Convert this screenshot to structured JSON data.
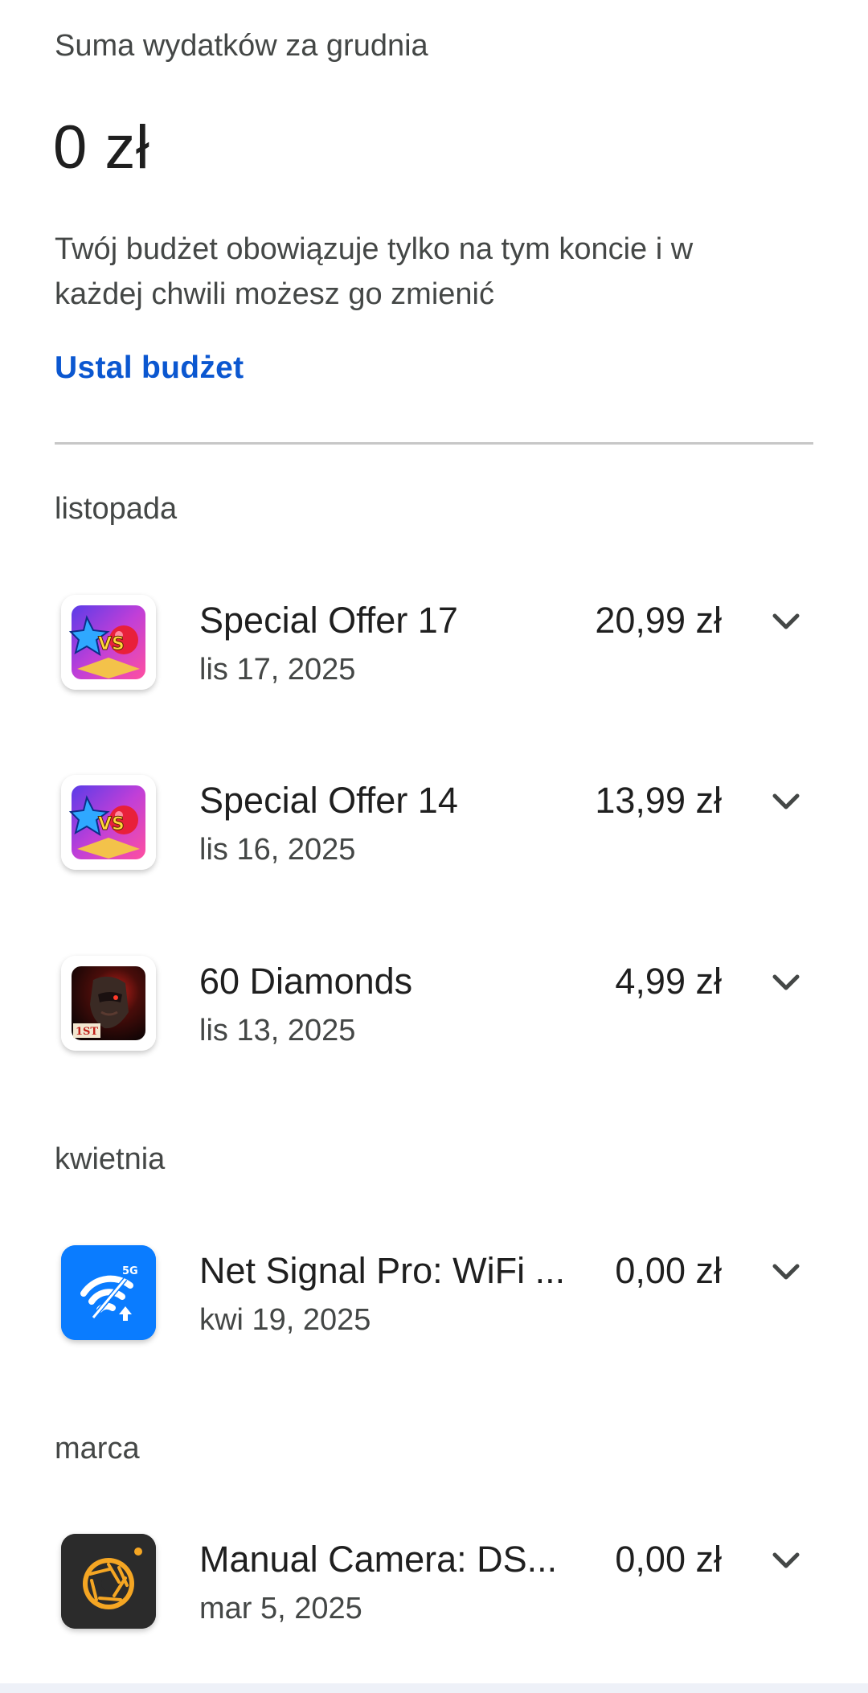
{
  "summary": {
    "label": "Suma wydatków za grudnia",
    "total": "0 zł",
    "description": "Twój budżet obowiązuje tylko na tym koncie i w każdej chwili możesz go zmienić",
    "set_budget_link": "Ustal budżet"
  },
  "groups": [
    {
      "month": "listopada",
      "items": [
        {
          "title": "Special Offer 17",
          "date": "lis 17, 2025",
          "price": "20,99 zł",
          "icon": "game-vs-icon"
        },
        {
          "title": "Special Offer 14",
          "date": "lis 16, 2025",
          "price": "13,99 zł",
          "icon": "game-vs-icon"
        },
        {
          "title": "60 Diamonds",
          "date": "lis 13, 2025",
          "price": "4,99 zł",
          "icon": "warrior-game-icon"
        }
      ]
    },
    {
      "month": "kwietnia",
      "items": [
        {
          "title": "Net Signal Pro: WiFi ...",
          "date": "kwi 19, 2025",
          "price": "0,00 zł",
          "icon": "wifi-5g-icon"
        }
      ]
    },
    {
      "month": "marca",
      "items": [
        {
          "title": "Manual Camera: DS...",
          "date": "mar 5, 2025",
          "price": "0,00 zł",
          "icon": "camera-aperture-icon"
        }
      ]
    }
  ],
  "colors": {
    "link": "#0b57d0",
    "primary_text": "#1f1f1f",
    "secondary_text": "#444746",
    "divider": "#c7c7c7",
    "wifi_icon_bg": "#0a7cff",
    "camera_icon_bg": "#2b2b2b",
    "camera_accent": "#f5a623"
  }
}
